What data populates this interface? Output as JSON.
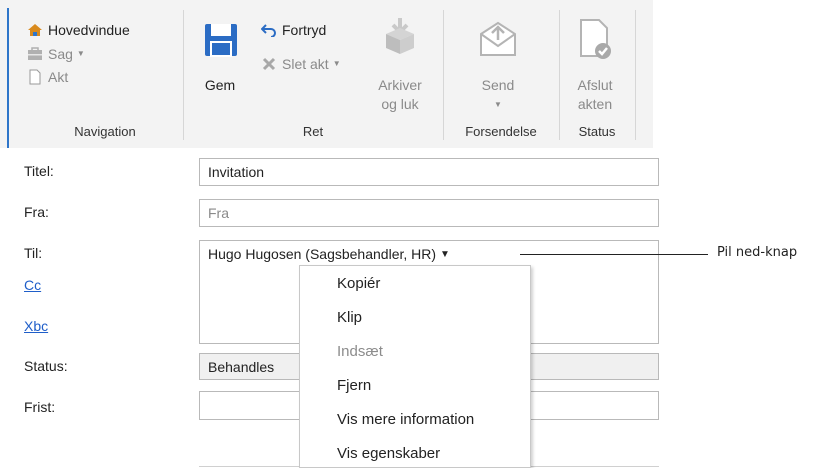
{
  "ribbon": {
    "navigation": {
      "items": [
        {
          "label": "Hovedvindue",
          "icon": "home-icon"
        },
        {
          "label": "Sag",
          "icon": "case-icon",
          "has_dropdown": true
        },
        {
          "label": "Akt",
          "icon": "document-icon"
        }
      ],
      "group_label": "Navigation"
    },
    "ret": {
      "save_label": "Gem",
      "undo_label": "Fortryd",
      "delete_label": "Slet akt",
      "archive_label_line1": "Arkiver",
      "archive_label_line2": "og luk",
      "group_label": "Ret"
    },
    "forsendelse": {
      "send_label": "Send",
      "group_label": "Forsendelse"
    },
    "status": {
      "close_label_line1": "Afslut",
      "close_label_line2": "akten",
      "group_label": "Status"
    }
  },
  "form": {
    "title_label": "Titel:",
    "title_value": "Invitation",
    "from_label": "Fra:",
    "from_placeholder": "Fra",
    "to_label": "Til:",
    "to_value": "Hugo Hugosen (Sagsbehandler, HR)",
    "cc_label": "Cc",
    "bcc_label": "Xbc",
    "status_label": "Status:",
    "status_value": "Behandles",
    "deadline_label": "Frist:"
  },
  "context_menu": {
    "items": [
      {
        "label": "Kopiér",
        "enabled": true
      },
      {
        "label": "Klip",
        "enabled": true
      },
      {
        "label": "Indsæt",
        "enabled": false
      },
      {
        "label": "Fjern",
        "enabled": true
      },
      {
        "label": "Vis mere information",
        "enabled": true
      },
      {
        "label": "Vis egenskaber",
        "enabled": true
      }
    ]
  },
  "callout": {
    "label": "Pil ned-knap"
  },
  "colors": {
    "accent": "#2e75c9",
    "save_icon": "#2b6cc4",
    "undo_icon": "#2b6cc4",
    "link": "#1f5ec9"
  }
}
